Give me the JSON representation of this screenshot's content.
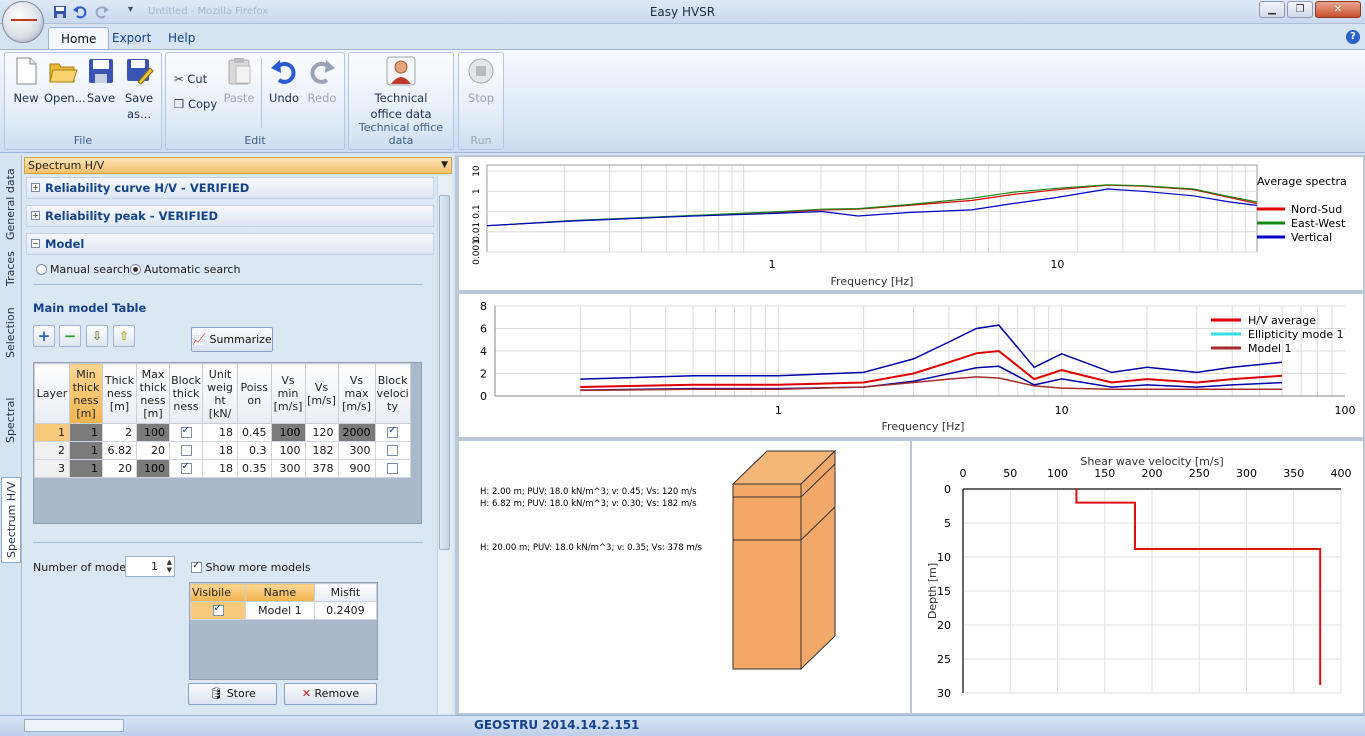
{
  "window": {
    "title": "Easy HVSR",
    "faded_title": "Untitled - Mozilla Firefox"
  },
  "ribbon": {
    "tabs": [
      "Home",
      "Export",
      "Help"
    ],
    "groups": {
      "file": {
        "label": "File",
        "new": "New",
        "open": "Open...",
        "save": "Save",
        "save_as": "Save as..."
      },
      "edit": {
        "label": "Edit",
        "cut": "Cut",
        "copy": "Copy",
        "paste": "Paste",
        "undo": "Undo",
        "redo": "Redo"
      },
      "technical": {
        "label": "Technical office data",
        "button": "Technical office data"
      },
      "run": {
        "label": "Run",
        "stop": "Stop"
      }
    }
  },
  "side_tabs": [
    "General data",
    "Traces",
    "Selection",
    "Spectral analysis",
    "Spectrum H/V"
  ],
  "panel": {
    "combo_value": "Spectrum H/V",
    "sections": [
      "Reliability curve H/V - VERIFIED",
      "Reliability peak - VERIFIED",
      "Model"
    ],
    "search": {
      "manual": "Manual search",
      "automatic": "Automatic search",
      "selected": "automatic"
    },
    "table_title": "Main model Table",
    "summarize": "Summarize",
    "columns": [
      "Layer",
      "Min thick ness [m]",
      "Thick ness [m]",
      "Max thick ness [m]",
      "Block thick ness",
      "Unit weig ht [kN/",
      "Poiss on",
      "Vs min [m/s]",
      "Vs [m/s]",
      "Vs max [m/s]",
      "Block veloci ty"
    ],
    "rows": [
      {
        "layer": "1",
        "min": "1",
        "thick": "2",
        "max": "100",
        "block_t": true,
        "unit": "18",
        "poisson": "0.45",
        "vsmin": "100",
        "vs": "120",
        "vsmax": "2000",
        "block_v": true
      },
      {
        "layer": "2",
        "min": "1",
        "thick": "6.82",
        "max": "20",
        "block_t": false,
        "unit": "18",
        "poisson": "0.3",
        "vsmin": "100",
        "vs": "182",
        "vsmax": "300",
        "block_v": false
      },
      {
        "layer": "3",
        "min": "1",
        "thick": "20",
        "max": "100",
        "block_t": true,
        "unit": "18",
        "poisson": "0.35",
        "vsmin": "300",
        "vs": "378",
        "vsmax": "900",
        "block_v": false
      }
    ],
    "num_modes_label": "Number of modes:",
    "num_modes": "1",
    "show_more": "Show more models",
    "models_cols": [
      "Visibile",
      "Name",
      "Misfit"
    ],
    "models": [
      {
        "visible": true,
        "name": "Model 1",
        "misfit": "0.2409"
      }
    ],
    "store": "Store",
    "remove": "Remove"
  },
  "status": {
    "version": "GEOSTRU 2014.14.2.151"
  },
  "charts": {
    "spectra": {
      "title": "Average spectra",
      "xlabel": "Frequency [Hz]",
      "legend": [
        "Nord-Sud",
        "East-West",
        "Vertical"
      ],
      "colors": [
        "#e00000",
        "#118811",
        "#0000cc"
      ],
      "xticks": [
        "1",
        "10"
      ],
      "yticks": [
        "10",
        "1",
        "0.1",
        "0.01",
        "0.001"
      ]
    },
    "hv": {
      "xlabel": "Frequency [Hz]",
      "legend": [
        "H/V average",
        "Ellipticity mode 1",
        "Model 1"
      ],
      "colors": [
        "#e00000",
        "#33e0e8",
        "#a52a2a",
        "#0000aa"
      ],
      "xticks": [
        "1",
        "10",
        "100"
      ],
      "yticks": [
        "8",
        "6",
        "4",
        "2",
        "0"
      ]
    },
    "layers": [
      "H: 2.00 m; PUV: 18.0 kN/m^3; v: 0.45; Vs: 120 m/s",
      "H: 6.82 m; PUV: 18.0 kN/m^3; v: 0.30; Vs: 182 m/s",
      "H: 20.00 m; PUV: 18.0 kN/m^3; v: 0.35; Vs: 378 m/s"
    ],
    "profile": {
      "xlabel": "Shear wave velocity [m/s]",
      "ylabel": "Depth [m]",
      "xticks": [
        "0",
        "50",
        "100",
        "150",
        "200",
        "250",
        "300",
        "350",
        "400"
      ],
      "yticks": [
        "0",
        "5",
        "10",
        "15",
        "20",
        "25",
        "30"
      ]
    }
  },
  "chart_data": [
    {
      "type": "line",
      "title": "Average spectra",
      "xlabel": "Frequency [Hz]",
      "x": [
        0.1,
        0.2,
        0.5,
        1,
        1.5,
        2,
        3,
        5,
        7,
        10,
        15,
        20,
        30,
        40,
        50
      ],
      "series": [
        {
          "name": "Nord-Sud",
          "values": [
            0.02,
            0.035,
            0.06,
            0.09,
            0.12,
            0.13,
            0.2,
            0.35,
            0.7,
            1.2,
            2.0,
            1.8,
            1.2,
            0.5,
            0.25
          ]
        },
        {
          "name": "East-West",
          "values": [
            0.02,
            0.036,
            0.062,
            0.095,
            0.13,
            0.14,
            0.22,
            0.45,
            0.9,
            1.4,
            2.1,
            1.9,
            1.3,
            0.55,
            0.3
          ]
        },
        {
          "name": "Vertical",
          "values": [
            0.02,
            0.034,
            0.058,
            0.08,
            0.1,
            0.06,
            0.09,
            0.12,
            0.25,
            0.5,
            1.3,
            1.0,
            0.6,
            0.3,
            0.2
          ]
        }
      ],
      "xscale": "log",
      "yscale": "log"
    },
    {
      "type": "line",
      "xlabel": "Frequency [Hz]",
      "ylim": [
        0,
        8
      ],
      "x": [
        0.2,
        0.5,
        1,
        2,
        3,
        4,
        5,
        6,
        8,
        10,
        15,
        20,
        30,
        40,
        60
      ],
      "series": [
        {
          "name": "H/V average",
          "values": [
            0.8,
            1.0,
            1.0,
            1.2,
            2.0,
            3.0,
            3.8,
            4.0,
            1.5,
            2.3,
            1.2,
            1.5,
            1.2,
            1.5,
            1.8
          ]
        },
        {
          "name": "Model 1",
          "values": [
            0.5,
            0.6,
            0.6,
            0.8,
            1.2,
            1.5,
            1.7,
            1.6,
            0.9,
            0.7,
            0.6,
            0.6,
            0.6,
            0.6,
            0.6
          ]
        }
      ],
      "xscale": "log"
    },
    {
      "type": "line",
      "xlabel": "Shear wave velocity [m/s]",
      "ylabel": "Depth [m]",
      "x": [
        120,
        120,
        182,
        182,
        378,
        378
      ],
      "y": [
        0,
        2,
        2,
        8.82,
        8.82,
        28.82
      ],
      "xlim": [
        0,
        400
      ],
      "ylim": [
        0,
        30
      ]
    }
  ]
}
